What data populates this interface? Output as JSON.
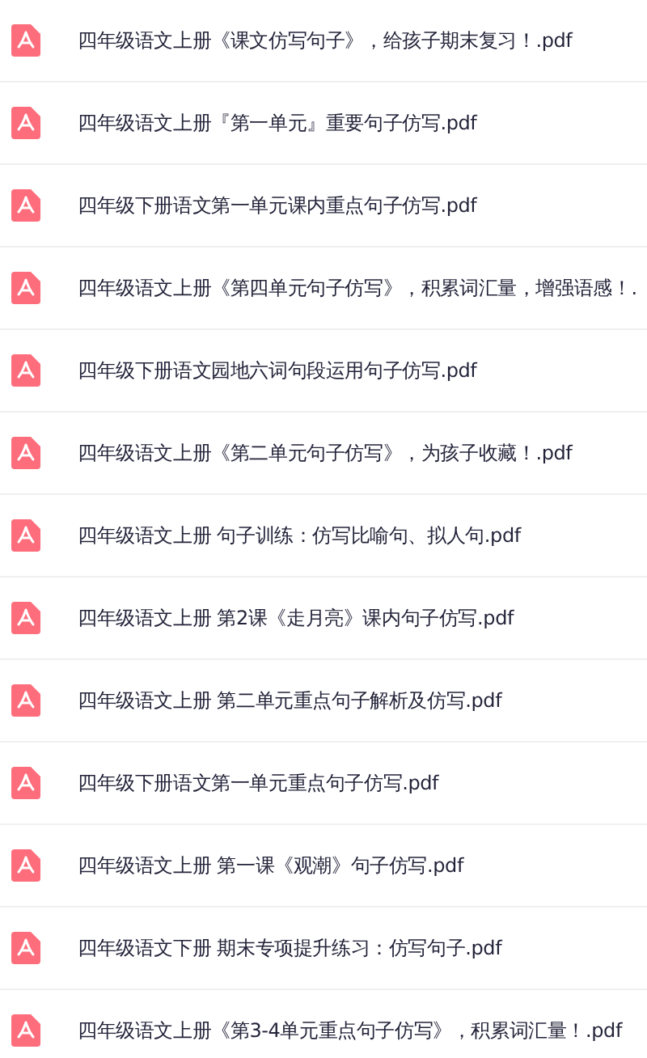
{
  "files": [
    {
      "name": "四年级语文上册《课文仿写句子》，给孩子期末复习！.pdf"
    },
    {
      "name": "四年级语文上册『第一单元』重要句子仿写.pdf"
    },
    {
      "name": "四年级下册语文第一单元课内重点句子仿写.pdf"
    },
    {
      "name": "四年级语文上册《第四单元句子仿写》，积累词汇量，增强语感！."
    },
    {
      "name": "四年级下册语文园地六词句段运用句子仿写.pdf"
    },
    {
      "name": "四年级语文上册《第二单元句子仿写》，为孩子收藏！.pdf"
    },
    {
      "name": "四年级语文上册 句子训练：仿写比喻句、拟人句.pdf"
    },
    {
      "name": "四年级语文上册 第2课《走月亮》课内句子仿写.pdf"
    },
    {
      "name": "四年级语文上册 第二单元重点句子解析及仿写.pdf"
    },
    {
      "name": "四年级下册语文第一单元重点句子仿写.pdf"
    },
    {
      "name": "四年级语文上册 第一课《观潮》句子仿写.pdf"
    },
    {
      "name": "四年级语文下册 期末专项提升练习：仿写句子.pdf"
    },
    {
      "name": "四年级语文上册《第3-4单元重点句子仿写》，积累词汇量！.pdf"
    }
  ]
}
